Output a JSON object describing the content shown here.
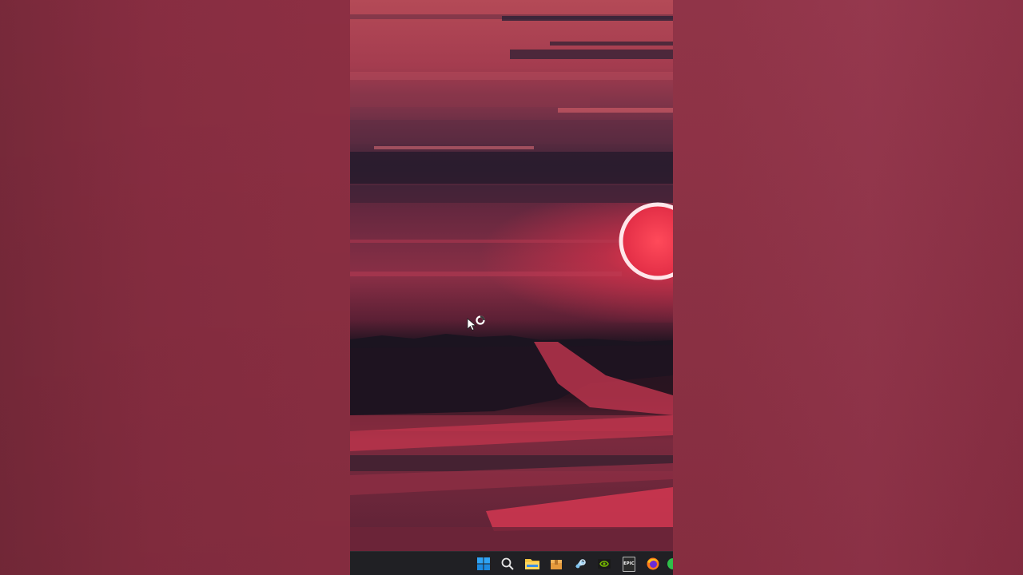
{
  "desktop": {
    "background": {
      "left_color": "#7f2b3d",
      "right_color": "#93344a"
    },
    "wallpaper": {
      "description_icon": "red-sunset-road-wallpaper-icon",
      "accent": "#ff4d5e"
    }
  },
  "taskbar": {
    "items": [
      {
        "name": "start-button",
        "icon": "windows-logo-icon"
      },
      {
        "name": "search-button",
        "icon": "search-icon"
      },
      {
        "name": "file-explorer-button",
        "icon": "folder-icon"
      },
      {
        "name": "app-button-package",
        "icon": "package-icon"
      },
      {
        "name": "steam-button",
        "icon": "steam-icon"
      },
      {
        "name": "nvidia-button",
        "icon": "nvidia-icon"
      },
      {
        "name": "epic-games-button",
        "icon": "epic-games-icon",
        "label": "EPIC"
      },
      {
        "name": "firefox-button",
        "icon": "firefox-icon"
      },
      {
        "name": "app-button-green",
        "icon": "green-app-icon"
      }
    ]
  },
  "cursor": {
    "icon": "busy-cursor-icon"
  }
}
